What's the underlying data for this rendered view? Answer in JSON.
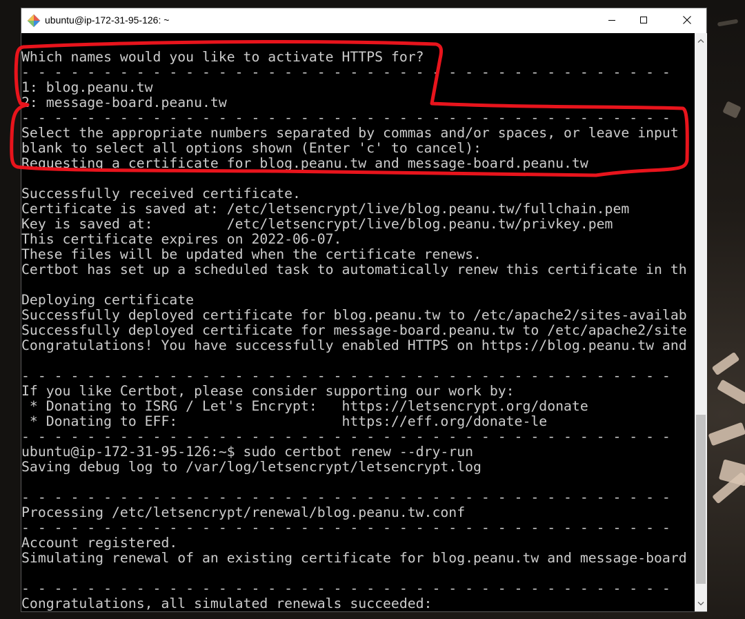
{
  "window": {
    "title": "ubuntu@ip-172-31-95-126: ~",
    "controls": {
      "minimize_icon": "minimize-icon",
      "maximize_icon": "maximize-icon",
      "close_icon": "close-icon"
    }
  },
  "terminal": {
    "lines": [
      "Which names would you like to activate HTTPS for?",
      "- - - - - - - - - - - - - - - - - - - - - - - - - - - - - - - - - - - - - - - -",
      "1: blog.peanu.tw",
      "2: message-board.peanu.tw",
      "- - - - - - - - - - - - - - - - - - - - - - - - - - - - - - - - - - - - - - - -",
      "Select the appropriate numbers separated by commas and/or spaces, or leave input",
      "blank to select all options shown (Enter 'c' to cancel):",
      "Requesting a certificate for blog.peanu.tw and message-board.peanu.tw",
      "",
      "Successfully received certificate.",
      "Certificate is saved at: /etc/letsencrypt/live/blog.peanu.tw/fullchain.pem",
      "Key is saved at:         /etc/letsencrypt/live/blog.peanu.tw/privkey.pem",
      "This certificate expires on 2022-06-07.",
      "These files will be updated when the certificate renews.",
      "Certbot has set up a scheduled task to automatically renew this certificate in th",
      "",
      "Deploying certificate",
      "Successfully deployed certificate for blog.peanu.tw to /etc/apache2/sites-availab",
      "Successfully deployed certificate for message-board.peanu.tw to /etc/apache2/site",
      "Congratulations! You have successfully enabled HTTPS on https://blog.peanu.tw and",
      "",
      "- - - - - - - - - - - - - - - - - - - - - - - - - - - - - - - - - - - - - - - -",
      "If you like Certbot, please consider supporting our work by:",
      " * Donating to ISRG / Let's Encrypt:   https://letsencrypt.org/donate",
      " * Donating to EFF:                    https://eff.org/donate-le",
      "- - - - - - - - - - - - - - - - - - - - - - - - - - - - - - - - - - - - - - - -",
      "ubuntu@ip-172-31-95-126:~$ sudo certbot renew --dry-run",
      "Saving debug log to /var/log/letsencrypt/letsencrypt.log",
      "",
      "- - - - - - - - - - - - - - - - - - - - - - - - - - - - - - - - - - - - - - - -",
      "Processing /etc/letsencrypt/renewal/blog.peanu.tw.conf",
      "- - - - - - - - - - - - - - - - - - - - - - - - - - - - - - - - - - - - - - - -",
      "Account registered.",
      "Simulating renewal of an existing certificate for blog.peanu.tw and message-board",
      "",
      "- - - - - - - - - - - - - - - - - - - - - - - - - - - - - - - - - - - - - - - -",
      "Congratulations, all simulated renewals succeeded:"
    ]
  },
  "colors": {
    "terminal_background": "#000000",
    "terminal_text": "#cccccc",
    "annotation_highlight": "#e8141c",
    "titlebar": "#ffffff"
  }
}
